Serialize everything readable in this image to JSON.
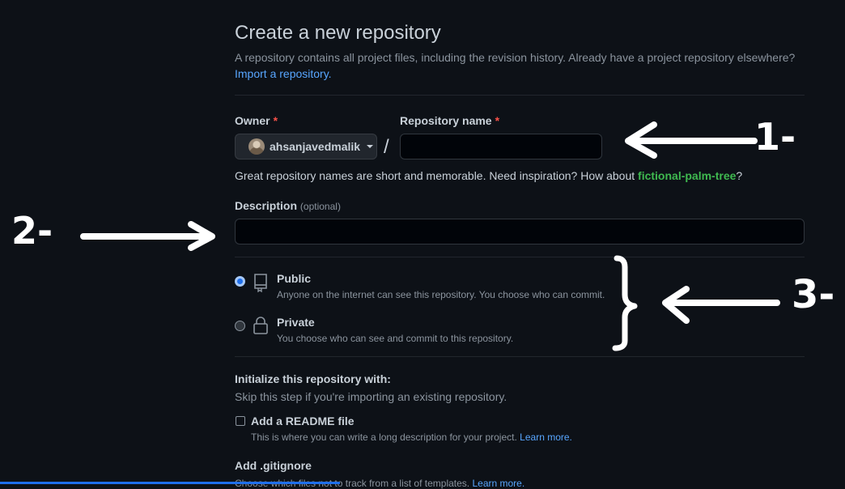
{
  "header": {
    "title": "Create a new repository",
    "subtitle": "A repository contains all project files, including the revision history. Already have a project repository elsewhere?",
    "import_link": "Import a repository."
  },
  "owner": {
    "label": "Owner",
    "required_mark": "*",
    "value": "ahsanjavedmalik"
  },
  "separator": "/",
  "repo_name": {
    "label": "Repository name",
    "required_mark": "*",
    "value": "",
    "hint_prefix": "Great repository names are short and memorable. Need inspiration? How about ",
    "suggestion": "fictional-palm-tree",
    "hint_suffix": "?"
  },
  "description": {
    "label": "Description",
    "optional": "(optional)",
    "value": ""
  },
  "visibility": {
    "public": {
      "title": "Public",
      "desc": "Anyone on the internet can see this repository. You choose who can commit.",
      "selected": true
    },
    "private": {
      "title": "Private",
      "desc": "You choose who can see and commit to this repository.",
      "selected": false
    }
  },
  "initialize": {
    "heading": "Initialize this repository with:",
    "subtext": "Skip this step if you're importing an existing repository.",
    "readme": {
      "label": "Add a README file",
      "desc": "This is where you can write a long description for your project.",
      "learn_more": "Learn more.",
      "checked": false
    },
    "gitignore_heading": "Add .gitignore",
    "gitignore_desc": "Choose which files not to track from a list of templates.",
    "gitignore_learn_more": "Learn more."
  },
  "annotations": {
    "one": "1-",
    "two": "2-",
    "three": "3-"
  },
  "colors": {
    "background": "#0d1117",
    "link": "#58a6ff",
    "suggestion": "#3fb950",
    "required": "#f85149"
  }
}
